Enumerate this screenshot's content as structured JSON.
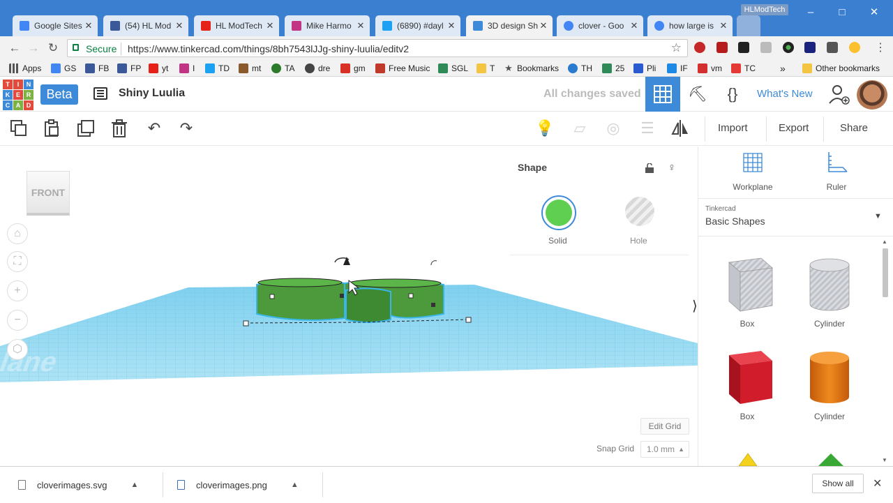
{
  "browser": {
    "tabs": [
      {
        "label": "Google Sites",
        "color": "#4285f4"
      },
      {
        "label": "(54) HL Mod",
        "color": "#3b5998"
      },
      {
        "label": "HL ModTech",
        "color": "#e62117"
      },
      {
        "label": "Mike Harmo",
        "color": "#c13584"
      },
      {
        "label": "(6890) #dayl",
        "color": "#1da1f2"
      },
      {
        "label": "3D design Sh",
        "color": "#3d8ad8",
        "active": true
      },
      {
        "label": "clover - Goo",
        "color": "#4285f4"
      },
      {
        "label": "how large is",
        "color": "#4285f4"
      }
    ],
    "profile_name": "HLModTech",
    "window_controls": {
      "minimize": "–",
      "maximize": "□",
      "close": "✕"
    },
    "nav": {
      "back": "←",
      "forward": "→",
      "reload": "↻"
    },
    "security_label": "Secure",
    "url": "https://www.tinkercad.com/things/8bh7543lJJg-shiny-luulia/editv2",
    "bookmarks": [
      {
        "label": "Apps",
        "color": "#555"
      },
      {
        "label": "GS",
        "color": "#4285f4"
      },
      {
        "label": "FB",
        "color": "#3b5998"
      },
      {
        "label": "FP",
        "color": "#3b5998"
      },
      {
        "label": "yt",
        "color": "#e62117"
      },
      {
        "label": "I",
        "color": "#c13584"
      },
      {
        "label": "TD",
        "color": "#1da1f2"
      },
      {
        "label": "mt",
        "color": "#8a5a2b"
      },
      {
        "label": "TA",
        "color": "#2a7a2a"
      },
      {
        "label": "dre",
        "color": "#444"
      },
      {
        "label": "gm",
        "color": "#d93025"
      },
      {
        "label": "Free Music",
        "color": "#c0392b"
      },
      {
        "label": "SGL",
        "color": "#2e8b57"
      },
      {
        "label": "T",
        "color": "#f4c542"
      },
      {
        "label": "Bookmarks",
        "color": "#555"
      },
      {
        "label": "TH",
        "color": "#2a7ad0"
      },
      {
        "label": "25",
        "color": "#2e8b57"
      },
      {
        "label": "Pli",
        "color": "#2a5ad0"
      },
      {
        "label": "IF",
        "color": "#1e88e5"
      },
      {
        "label": "vm",
        "color": "#d32f2f"
      },
      {
        "label": "TC",
        "color": "#e53935"
      }
    ],
    "bookmarks_overflow": "»",
    "other_bookmarks": "Other bookmarks"
  },
  "tinkercad": {
    "logo_letters": [
      "T",
      "I",
      "N",
      "K",
      "E",
      "R",
      "C",
      "A",
      "D"
    ],
    "logo_colors": [
      "#e24a3c",
      "#e24a3c",
      "#3d8ad8",
      "#3d8ad8",
      "#e24a3c",
      "#7cb342",
      "#3d8ad8",
      "#7cb342",
      "#e24a3c"
    ],
    "beta_label": "Beta",
    "design_title": "Shiny Luulia",
    "save_status": "All changes saved",
    "whats_new": "What's New"
  },
  "toolbar": {
    "import": "Import",
    "export": "Export",
    "share": "Share"
  },
  "workplane": {
    "view_cube_label": "FRONT",
    "watermark": "Workplane",
    "edit_grid": "Edit Grid",
    "snap_grid_label": "Snap Grid",
    "snap_grid_value": "1.0 mm"
  },
  "shape_panel": {
    "title": "Shape",
    "solid_label": "Solid",
    "hole_label": "Hole",
    "solid_color": "#5fcf52"
  },
  "right_panel": {
    "workplane_label": "Workplane",
    "ruler_label": "Ruler",
    "library_owner": "Tinkercad",
    "library_name": "Basic Shapes",
    "shapes": [
      {
        "label": "Box",
        "kind": "box-hole"
      },
      {
        "label": "Cylinder",
        "kind": "cylinder-hole"
      },
      {
        "label": "Box",
        "kind": "box-red"
      },
      {
        "label": "Cylinder",
        "kind": "cylinder-orange"
      }
    ]
  },
  "downloads": {
    "files": [
      "cloverimages.svg",
      "cloverimages.png"
    ],
    "show_all": "Show all"
  }
}
